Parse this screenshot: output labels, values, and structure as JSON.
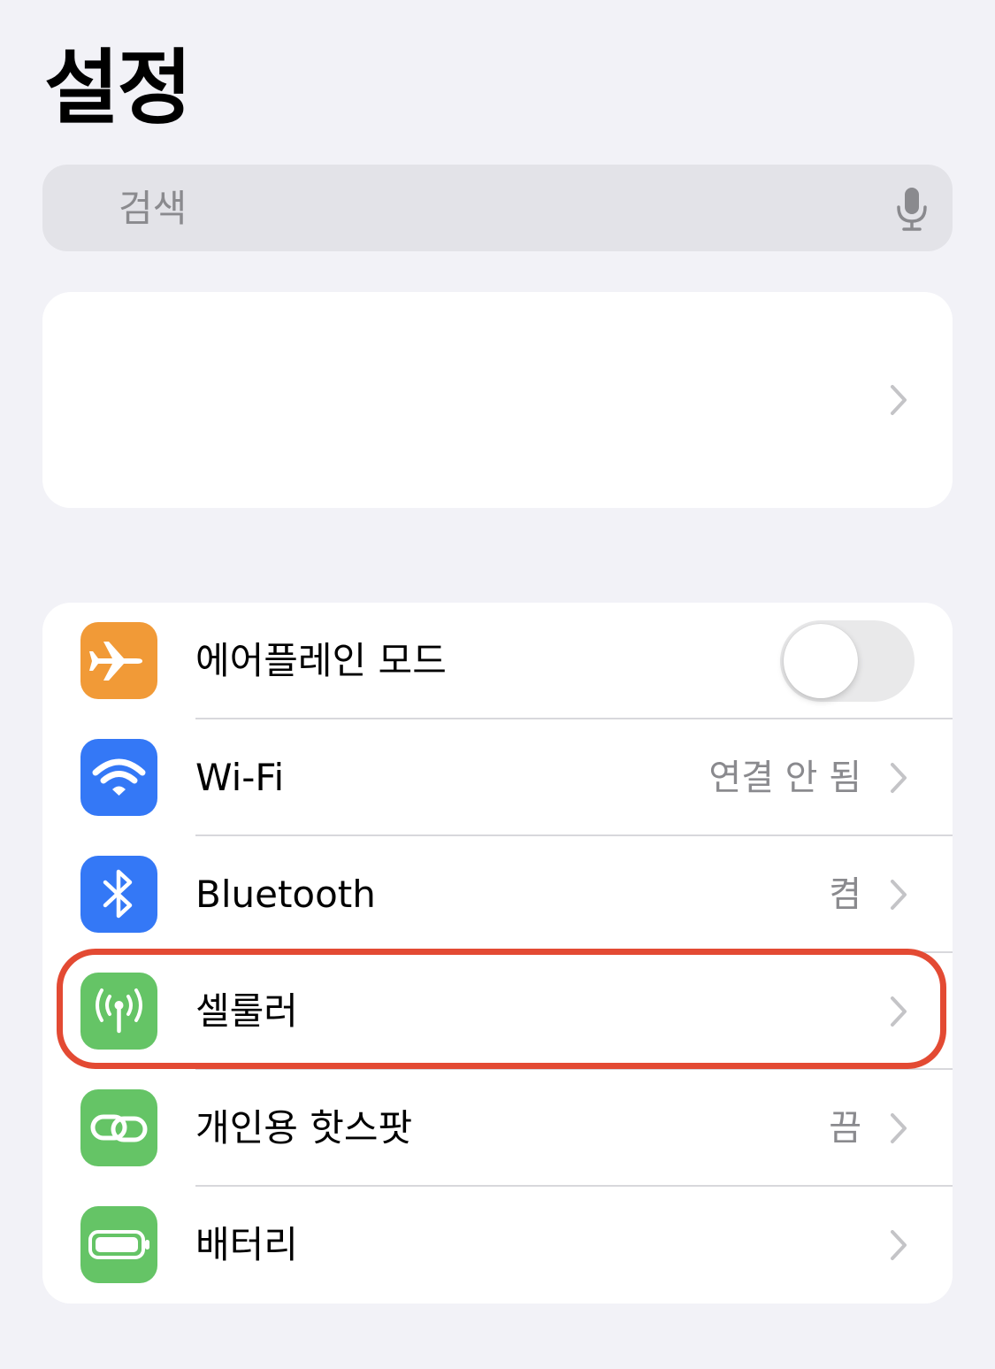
{
  "header": {
    "title": "설정"
  },
  "search": {
    "placeholder": "검색"
  },
  "settings": {
    "airplane_mode": {
      "label": "에어플레인 모드",
      "on": false,
      "icon": "airplane-icon",
      "color": "#f19a37"
    },
    "wifi": {
      "label": "Wi-Fi",
      "value": "연결 안 됨",
      "icon": "wifi-icon",
      "color": "#3478f6"
    },
    "bluetooth": {
      "label": "Bluetooth",
      "value": "켬",
      "icon": "bluetooth-icon",
      "color": "#3478f6"
    },
    "cellular": {
      "label": "셀룰러",
      "value": "",
      "icon": "antenna-icon",
      "color": "#65c466"
    },
    "hotspot": {
      "label": "개인용 핫스팟",
      "value": "끔",
      "icon": "link-icon",
      "color": "#65c466"
    },
    "battery": {
      "label": "배터리",
      "value": "",
      "icon": "battery-icon",
      "color": "#65c466"
    }
  },
  "highlight_color": "#e34a33"
}
